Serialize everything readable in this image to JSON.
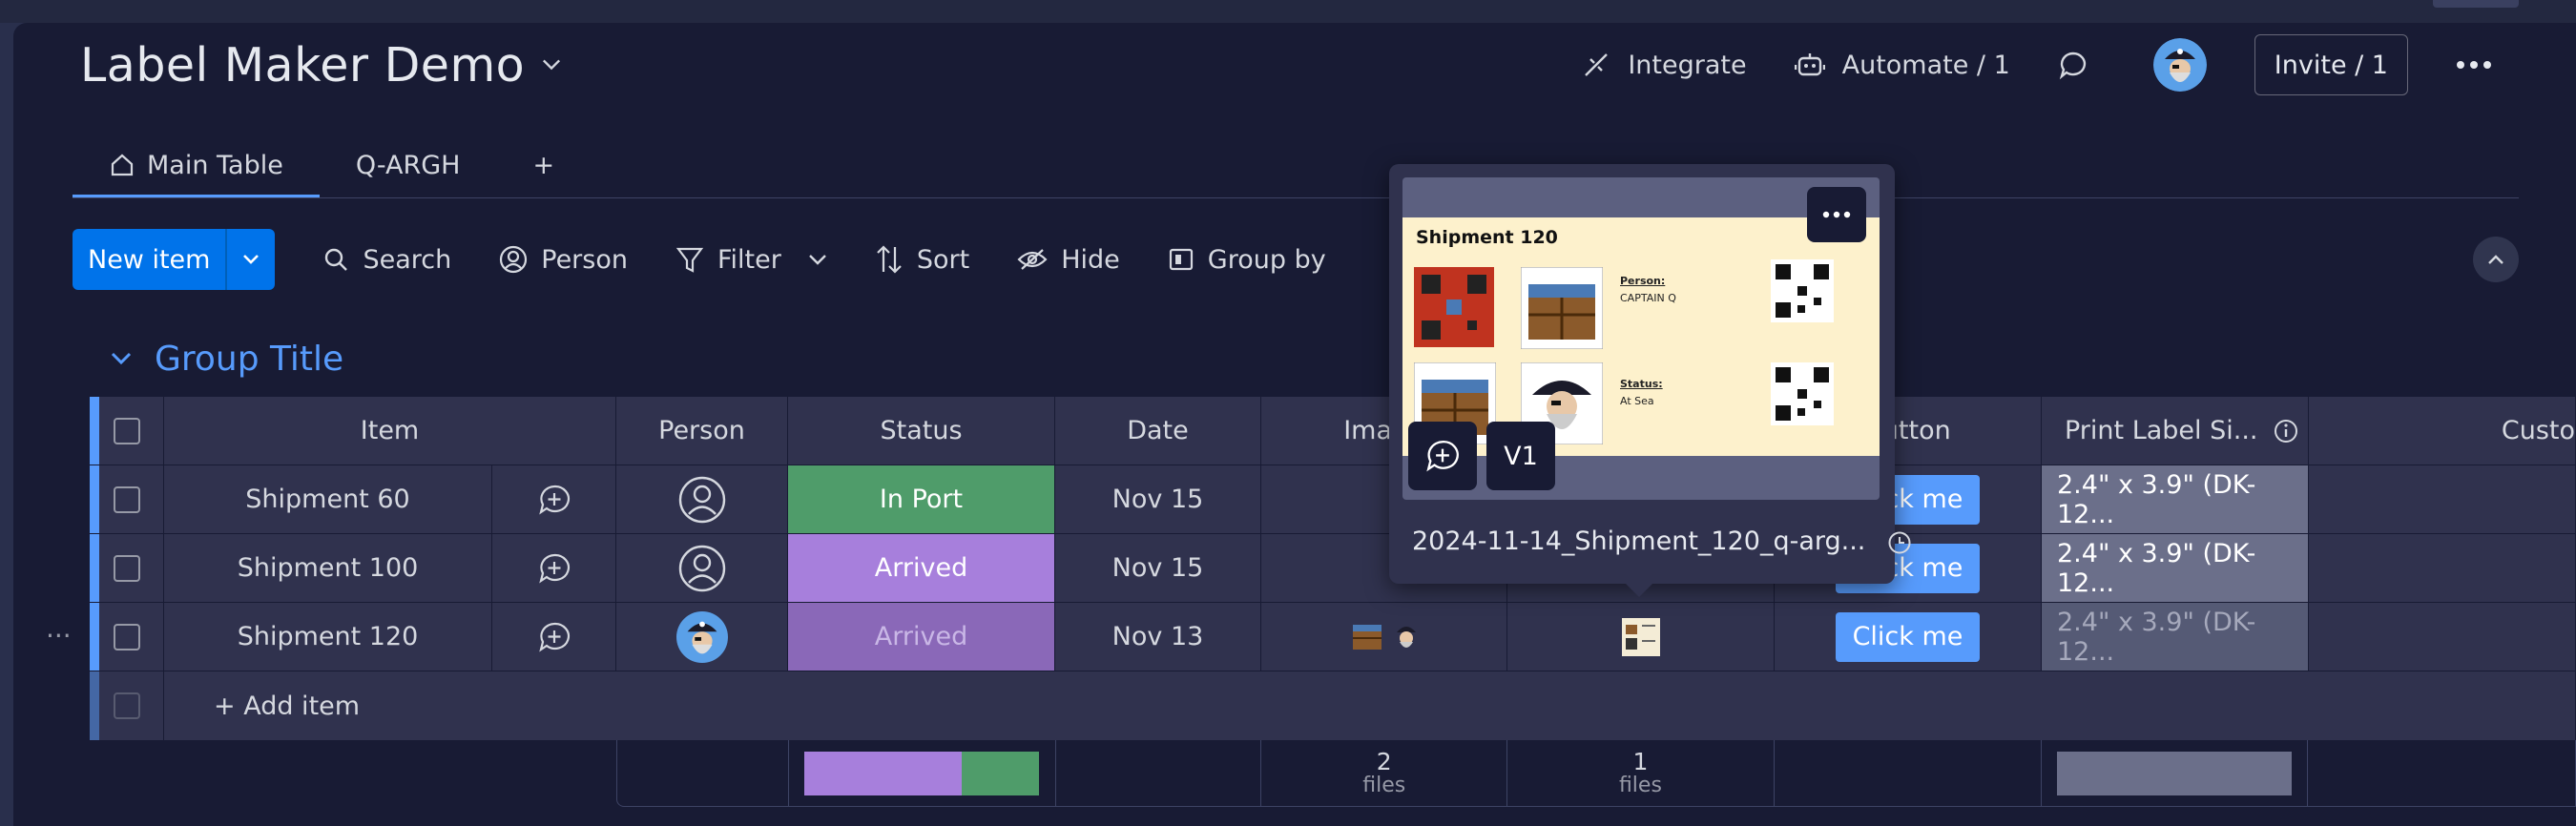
{
  "board": {
    "title": "Label Maker Demo",
    "actions": {
      "integrate": "Integrate",
      "automate": "Automate / 1",
      "invite": "Invite / 1"
    }
  },
  "tabs": [
    {
      "label": "Main Table",
      "active": true
    },
    {
      "label": "Q-ARGH",
      "active": false
    },
    {
      "label": "+",
      "active": false
    }
  ],
  "toolbar": {
    "new_item": "New item",
    "search": "Search",
    "person": "Person",
    "filter": "Filter",
    "sort": "Sort",
    "hide": "Hide",
    "group_by": "Group by"
  },
  "group": {
    "title": "Group Title",
    "color": "#579bfc"
  },
  "columns": [
    "Item",
    "Person",
    "Status",
    "Date",
    "Image",
    "Button",
    "Print Label Si...",
    "Custo"
  ],
  "rows": [
    {
      "item": "Shipment 60",
      "status": "In Port",
      "status_color": "#4f9c6a",
      "date": "Nov 15",
      "button": "Click me",
      "print": "2.4\" x 3.9\" (DK-12..."
    },
    {
      "item": "Shipment 100",
      "status": "Arrived",
      "status_color": "#a77fdc",
      "date": "Nov 15",
      "button": "Click me",
      "print": "2.4\" x 3.9\" (DK-12..."
    },
    {
      "item": "Shipment 120",
      "status": "Arrived",
      "status_color": "#8a68b8",
      "date": "Nov 13",
      "button": "Click me",
      "print": "2.4\" x 3.9\" (DK-12..."
    }
  ],
  "add_item": "+ Add item",
  "summary": {
    "status_distribution": [
      {
        "color": "#a77fdc",
        "fraction": 0.67
      },
      {
        "color": "#4f9c6a",
        "fraction": 0.33
      }
    ],
    "image_files": {
      "count": "2",
      "label": "files"
    },
    "file_files": {
      "count": "1",
      "label": "files"
    }
  },
  "popup": {
    "label_title": "Shipment 120",
    "person_label": "Person:",
    "person_value": "CAPTAIN Q",
    "status_label": "Status:",
    "status_value": "At Sea",
    "version": "V1",
    "file_name": "2024-11-14_Shipment_120_q-arg..."
  }
}
